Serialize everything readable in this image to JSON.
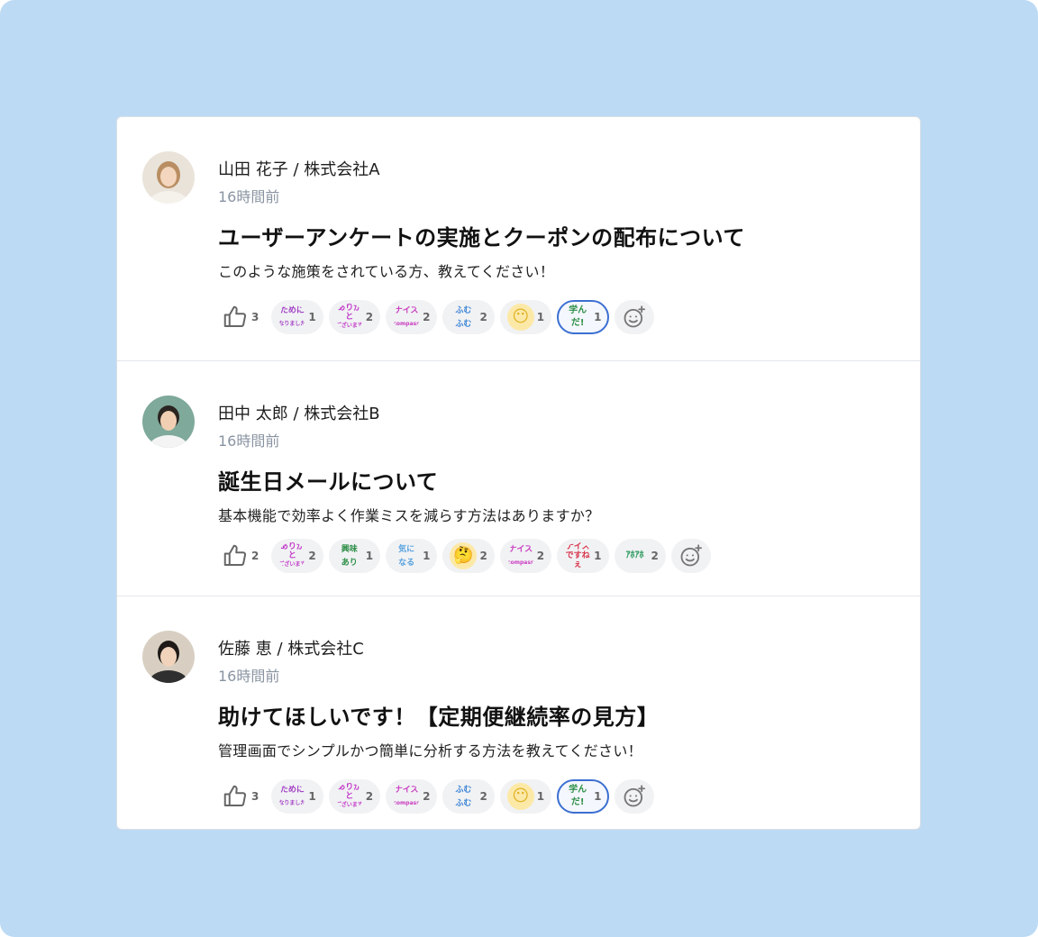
{
  "posts": [
    {
      "author": "山田 花子 / 株式会社A",
      "time": "16時間前",
      "title": "ユーザーアンケートの実施とクーポンの配布について",
      "body": "このような施策をされている方、教えてください！",
      "likes": "3",
      "reactions": [
        {
          "icon": "tameni-narimashita-stamp",
          "lines": [
            "ために",
            "なりました"
          ],
          "color": "#a23fc6",
          "count": "1",
          "active": false
        },
        {
          "icon": "arigatou-stamp",
          "lines": [
            "ありがと",
            "ございます"
          ],
          "color": "#c238c8",
          "count": "2",
          "active": false
        },
        {
          "icon": "nice-compass-stamp",
          "lines": [
            "ナイス",
            "compass"
          ],
          "color": "#c93cc0",
          "count": "2",
          "active": false
        },
        {
          "icon": "fumufumu-stamp",
          "lines": [
            "ふむ",
            "ふむ"
          ],
          "color": "#3c84d6",
          "count": "2",
          "active": false
        },
        {
          "icon": "face-emoji",
          "lines": [
            "😶"
          ],
          "color": "#e0b020",
          "count": "1",
          "active": false
        },
        {
          "icon": "mananda-stamp",
          "lines": [
            "学んだ!"
          ],
          "color": "#2e8f47",
          "count": "1",
          "active": true
        }
      ]
    },
    {
      "author": "田中 太郎 / 株式会社B",
      "time": "16時間前",
      "title": "誕生日メールについて",
      "body": "基本機能で効率よく作業ミスを減らす方法はありますか？",
      "likes": "2",
      "reactions": [
        {
          "icon": "arigatou-stamp",
          "lines": [
            "ありがと",
            "ございます"
          ],
          "color": "#c238c8",
          "count": "2",
          "active": false
        },
        {
          "icon": "kyoumi-ari-stamp",
          "lines": [
            "興味",
            "あり"
          ],
          "color": "#2e8f47",
          "count": "1",
          "active": false
        },
        {
          "icon": "ki-ni-naru-stamp",
          "lines": [
            "気に",
            "なる"
          ],
          "color": "#5aa3e0",
          "count": "1",
          "active": false
        },
        {
          "icon": "thinking-emoji",
          "lines": [
            "🤔"
          ],
          "color": "#e0b020",
          "count": "2",
          "active": false
        },
        {
          "icon": "nice-compass-stamp",
          "lines": [
            "ナイス",
            "compass"
          ],
          "color": "#c93cc0",
          "count": "2",
          "active": false
        },
        {
          "icon": "nice-desune-stamp",
          "lines": [
            "ナイス",
            "ですねぇ"
          ],
          "color": "#d8324a",
          "count": "1",
          "active": false
        },
        {
          "icon": "naruhodo-stamp",
          "lines": [
            "ｱﾎｱﾎ"
          ],
          "color": "#2e9a60",
          "count": "2",
          "active": false
        }
      ]
    },
    {
      "author": "佐藤 恵 / 株式会社C",
      "time": "16時間前",
      "title": "助けてほしいです！【定期便継続率の見方】",
      "body": "管理画面でシンプルかつ簡単に分析する方法を教えてください！",
      "likes": "3",
      "reactions": [
        {
          "icon": "tameni-narimashita-stamp",
          "lines": [
            "ために",
            "なりました"
          ],
          "color": "#a23fc6",
          "count": "1",
          "active": false
        },
        {
          "icon": "arigatou-stamp",
          "lines": [
            "ありがと",
            "ございます"
          ],
          "color": "#c238c8",
          "count": "2",
          "active": false
        },
        {
          "icon": "nice-compass-stamp",
          "lines": [
            "ナイス",
            "compass"
          ],
          "color": "#c93cc0",
          "count": "2",
          "active": false
        },
        {
          "icon": "fumufumu-stamp",
          "lines": [
            "ふむ",
            "ふむ"
          ],
          "color": "#3c84d6",
          "count": "2",
          "active": false
        },
        {
          "icon": "face-emoji",
          "lines": [
            "😶"
          ],
          "color": "#e0b020",
          "count": "1",
          "active": false
        },
        {
          "icon": "mananda-stamp",
          "lines": [
            "学んだ!"
          ],
          "color": "#2e8f47",
          "count": "1",
          "active": true
        }
      ]
    }
  ],
  "colors": {
    "background": "#bcdaf4",
    "card": "#ffffff",
    "active_border": "#3c6fd1",
    "time_text": "#8a94a2"
  }
}
